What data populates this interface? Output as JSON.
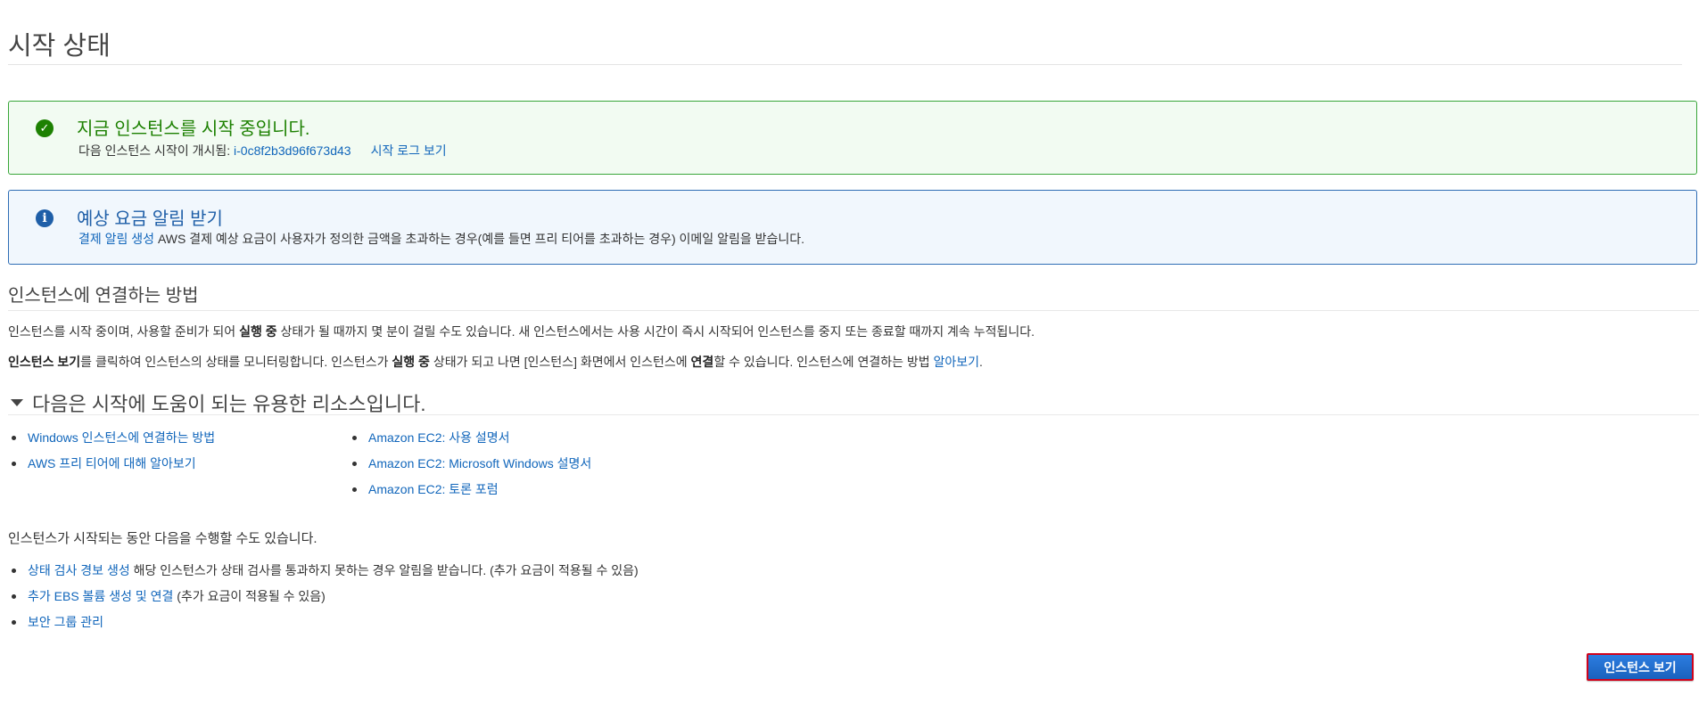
{
  "page": {
    "title": "시작 상태"
  },
  "success_alert": {
    "title": "지금 인스턴스를 시작 중입니다.",
    "body_prefix": "다음 인스턴스 시작이 개시됨: ",
    "instance_id": "i-0c8f2b3d96f673d43",
    "log_link": "시작 로그 보기"
  },
  "info_alert": {
    "title": "예상 요금 알림 받기",
    "link": "결제 알림 생성",
    "body": " AWS 결제 예상 요금이 사용자가 정의한 금액을 초과하는 경우(예를 들면 프리 티어를 초과하는 경우) 이메일 알림을 받습니다."
  },
  "connect_section": {
    "heading": "인스턴스에 연결하는 방법",
    "p1_a": "인스턴스를 시작 중이며, 사용할 준비가 되어 ",
    "p1_b": "실행 중",
    "p1_c": " 상태가 될 때까지 몇 분이 걸릴 수도 있습니다. 새 인스턴스에서는 사용 시간이 즉시 시작되어 인스턴스를 중지 또는 종료할 때까지 계속 누적됩니다.",
    "p2_a": "인스턴스 보기",
    "p2_b": "를 클릭하여 인스턴스의 상태를 모니터링합니다. 인스턴스가 ",
    "p2_c": "실행 중",
    "p2_d": " 상태가 되고 나면 [인스턴스] 화면에서 인스턴스에 ",
    "p2_e": "연결",
    "p2_f": "할 수 있습니다. 인스턴스에 연결하는 방법 ",
    "p2_link": "알아보기",
    "p2_end": "."
  },
  "resources": {
    "heading": "다음은 시작에 도움이 되는 유용한 리소스입니다.",
    "left": [
      "Windows 인스턴스에 연결하는 방법",
      "AWS 프리 티어에 대해 알아보기"
    ],
    "right": [
      "Amazon EC2: 사용 설명서",
      "Amazon EC2: Microsoft Windows 설명서",
      "Amazon EC2: 토론 포럼"
    ]
  },
  "doing": {
    "intro": "인스턴스가 시작되는 동안 다음을 수행할 수도 있습니다.",
    "items": [
      {
        "link": "상태 검사 경보 생성",
        "note": " 해당 인스턴스가 상태 검사를 통과하지 못하는 경우 알림을 받습니다. (추가 요금이 적용될 수 있음)"
      },
      {
        "link": "추가 EBS 볼륨 생성 및 연결",
        "note": " (추가 요금이 적용될 수 있음)"
      },
      {
        "link": "보안 그룹 관리",
        "note": ""
      }
    ]
  },
  "actions": {
    "view_instances": "인스턴스 보기"
  },
  "colors": {
    "success": "#1d8102",
    "info": "#1f5fa8",
    "link": "#1166bb",
    "button": "#1a62bd",
    "button_outline": "#d0021b"
  }
}
